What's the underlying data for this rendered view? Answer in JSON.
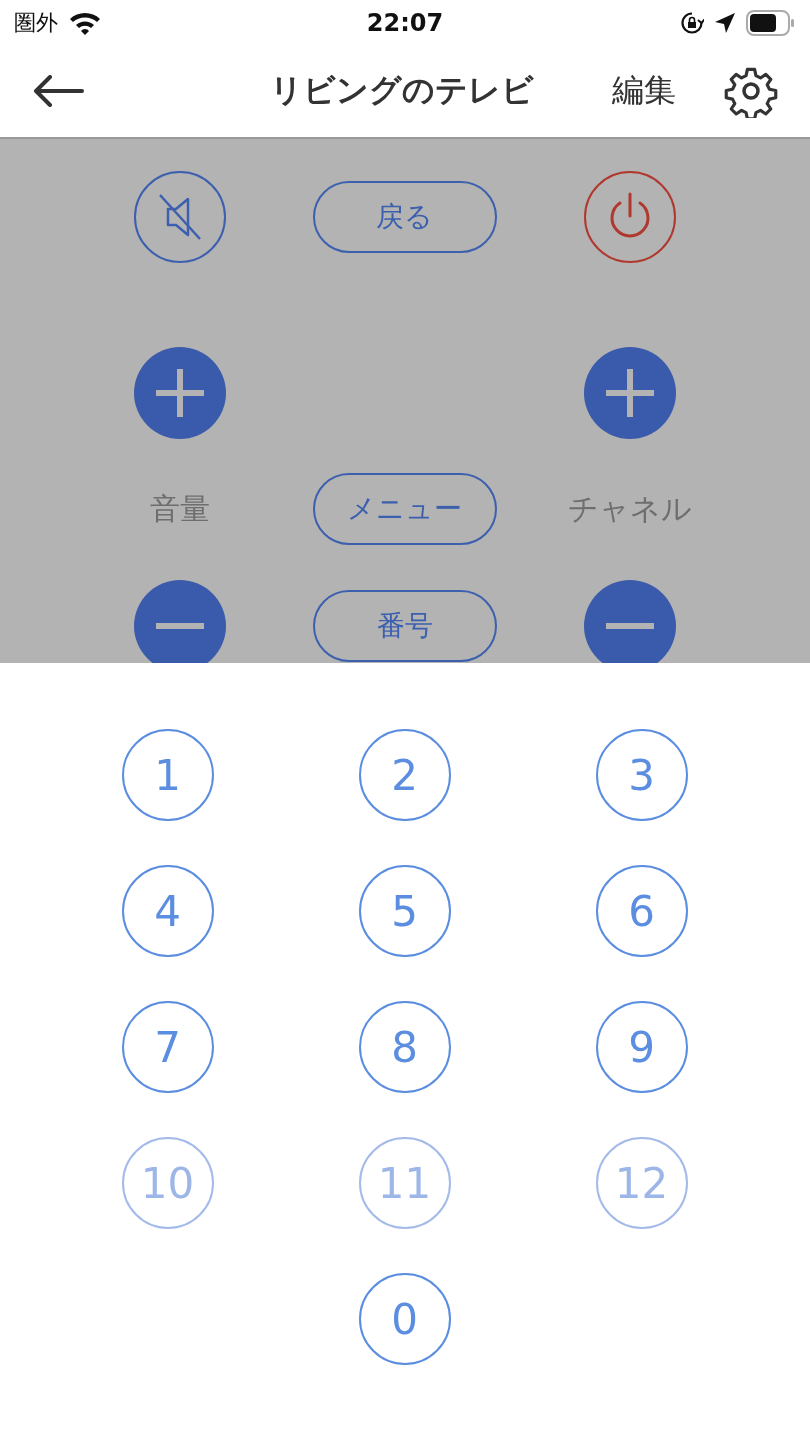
{
  "status_bar": {
    "carrier": "圏外",
    "time": "22:07"
  },
  "nav": {
    "title": "リビングのテレビ",
    "edit": "編集"
  },
  "remote": {
    "back": "戻る",
    "volume": "音量",
    "menu": "メニュー",
    "channel": "チャネル",
    "number": "番号"
  },
  "keypad": [
    [
      {
        "label": "1",
        "disabled": false
      },
      {
        "label": "2",
        "disabled": false
      },
      {
        "label": "3",
        "disabled": false
      }
    ],
    [
      {
        "label": "4",
        "disabled": false
      },
      {
        "label": "5",
        "disabled": false
      },
      {
        "label": "6",
        "disabled": false
      }
    ],
    [
      {
        "label": "7",
        "disabled": false
      },
      {
        "label": "8",
        "disabled": false
      },
      {
        "label": "9",
        "disabled": false
      }
    ],
    [
      {
        "label": "10",
        "disabled": true
      },
      {
        "label": "11",
        "disabled": true
      },
      {
        "label": "12",
        "disabled": true
      }
    ],
    [
      {
        "label": "0",
        "disabled": false
      }
    ]
  ]
}
